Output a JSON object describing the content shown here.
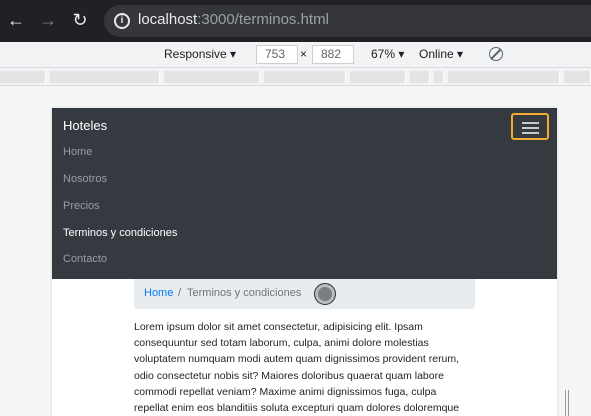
{
  "browser": {
    "url_host": "localhost",
    "url_path": ":3000/terminos.html",
    "back_icon": "arrow-left-icon",
    "forward_icon": "arrow-right-icon",
    "reload_icon": "reload-icon"
  },
  "device_toolbar": {
    "mode": "Responsive",
    "width": "753",
    "times": "×",
    "height": "882",
    "zoom": "67%",
    "network": "Online"
  },
  "navbar": {
    "brand": "Hoteles",
    "links": [
      {
        "label": "Home",
        "active": false
      },
      {
        "label": "Nosotros",
        "active": false
      },
      {
        "label": "Precios",
        "active": false
      },
      {
        "label": "Terminos y condiciones",
        "active": true
      },
      {
        "label": "Contacto",
        "active": false
      }
    ]
  },
  "breadcrumb": {
    "home": "Home",
    "separator": "/",
    "current": "Terminos y condiciones"
  },
  "content": {
    "paragraph": "Lorem ipsum dolor sit amet consectetur, adipisicing elit. Ipsam consequuntur sed totam laborum, culpa, animi dolore molestias voluptatem numquam modi autem quam dignissimos provident rerum, odio consectetur nobis sit? Maiores doloribus quaerat quam labore commodi repellat veniam? Maxime animi dignissimos fuga, culpa repellat enim eos blanditiis soluta excepturi quam dolores doloremque"
  },
  "colors": {
    "navbar_bg": "#343a40",
    "toggler_focus": "#f0ad32",
    "link_blue": "#007bff",
    "breadcrumb_bg": "#e9ecef"
  }
}
